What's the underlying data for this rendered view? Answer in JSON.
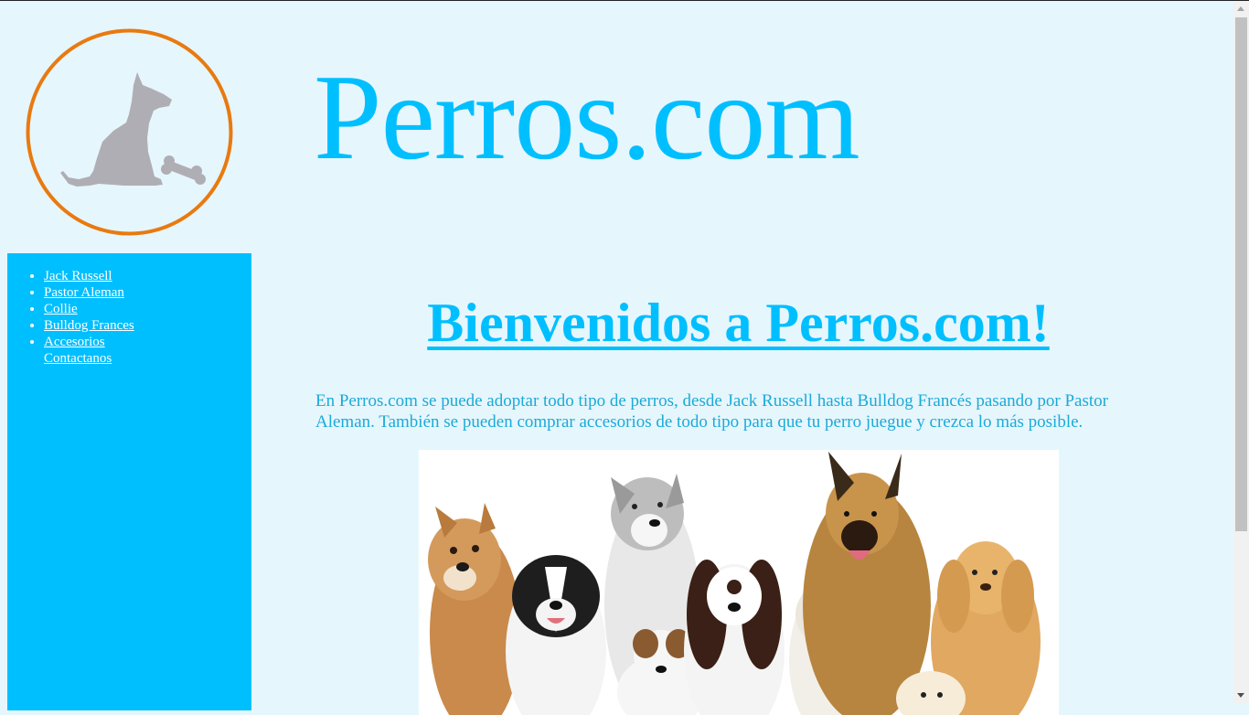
{
  "header": {
    "site_title": "Perros.com",
    "logo_icon": "dog-with-bone-icon"
  },
  "sidebar": {
    "items": [
      {
        "label": "Jack Russell",
        "bullet": true
      },
      {
        "label": "Pastor Aleman",
        "bullet": true
      },
      {
        "label": "Collie",
        "bullet": true
      },
      {
        "label": "Bulldog Frances",
        "bullet": true
      },
      {
        "label": "Accesorios",
        "bullet": true
      },
      {
        "label": "Contactanos",
        "bullet": false
      }
    ]
  },
  "main": {
    "heading": "Bienvenidos a Perros.com!",
    "intro": "En Perros.com se puede adoptar todo tipo de perros, desde Jack Russell hasta Bulldog Francés pasando por Pastor Aleman. También se pueden comprar accesorios de todo tipo para que tu perro juegue y crezca lo más posible.",
    "image_icon": "dogs-group-photo"
  },
  "colors": {
    "background": "#e6f6fd",
    "accent": "#00bfff",
    "logo_ring": "#e87a10",
    "logo_dog": "#b0aeb5"
  }
}
